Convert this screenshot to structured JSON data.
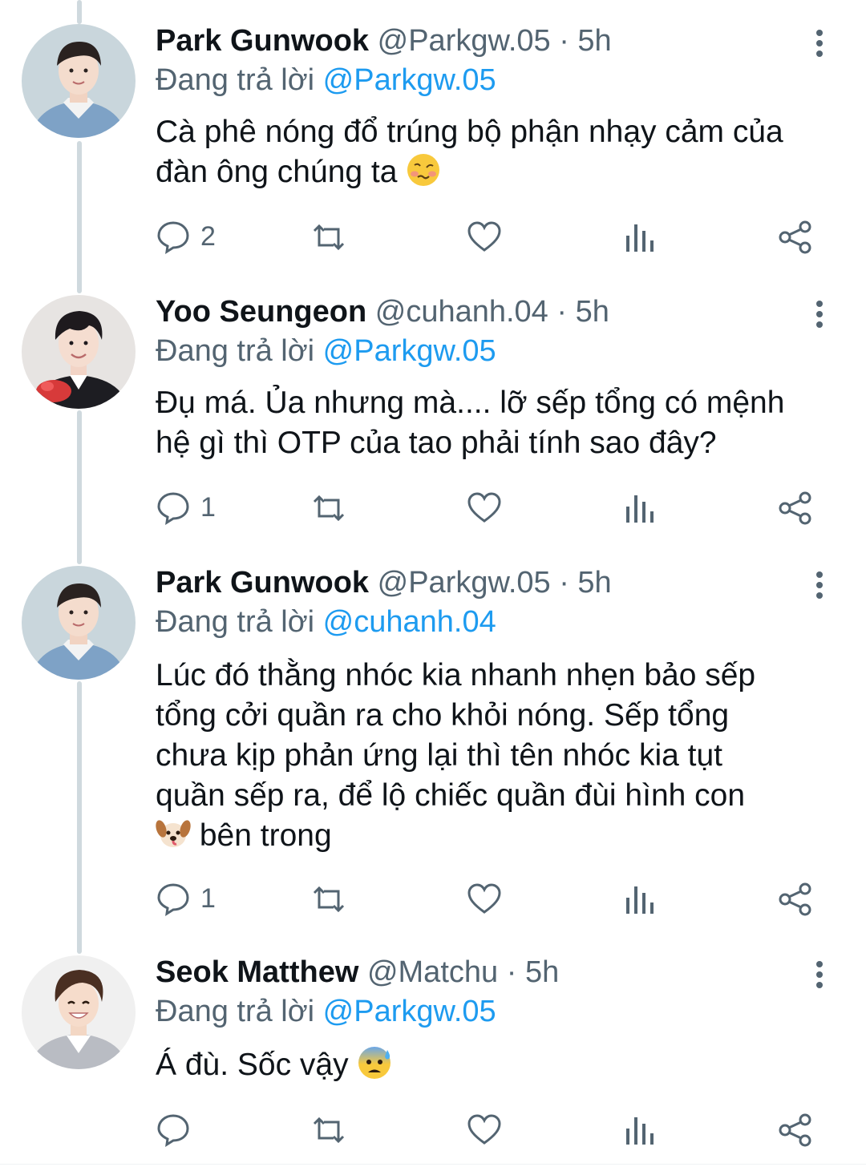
{
  "tweets": [
    {
      "name": "Park Gunwook",
      "handle": "@Parkgw.05",
      "dot": "·",
      "time": "5h",
      "reply_prefix": "Đang trả lời",
      "reply_to": "@Parkgw.05",
      "text": "Cà phê nóng đổ trúng bộ phận nhạy cảm của đàn ông chúng ta",
      "emoji": "woozy-face",
      "reply_count": "2",
      "avatar_bg": "#c9d6dc"
    },
    {
      "name": "Yoo Seungeon",
      "handle": "@cuhanh.04",
      "dot": "·",
      "time": "5h",
      "reply_prefix": "Đang trả lời",
      "reply_to": "@Parkgw.05",
      "text_line1": "Đụ má. Ủa nhưng mà.... lỡ sếp tổng có mệnh",
      "text_line2": "hệ gì thì OTP của tao phải tính sao đây?",
      "reply_count": "1",
      "avatar_bg": "#e7e4e2"
    },
    {
      "name": "Park Gunwook",
      "handle": "@Parkgw.05",
      "dot": "·",
      "time": "5h",
      "reply_prefix": "Đang trả lời",
      "reply_to": "@cuhanh.04",
      "text_line1": "Lúc đó thằng nhóc kia nhanh nhẹn bảo sếp",
      "text_line2": "tổng cởi quần ra cho khỏi nóng. Sếp tổng",
      "text_line3": "chưa kịp phản ứng lại thì tên nhóc kia tụt",
      "text_line4": "quần sếp ra, để lộ chiếc quần đùi hình con",
      "text_line5": "bên trong",
      "emoji": "dog-face",
      "reply_count": "1",
      "avatar_bg": "#c9d6dc"
    },
    {
      "name": "Seok Matthew",
      "handle": "@Matchu",
      "dot": "·",
      "time": "5h",
      "reply_prefix": "Đang trả lời",
      "reply_to": "@Parkgw.05",
      "text": "Á đù. Sốc vậy",
      "emoji": "anxious-face-with-sweat",
      "reply_count": "",
      "avatar_bg": "#f0f0f0"
    }
  ],
  "colors": {
    "text": "#0f1419",
    "muted": "#536471",
    "link": "#1d9bf0",
    "thread_line": "#cfd9de"
  }
}
